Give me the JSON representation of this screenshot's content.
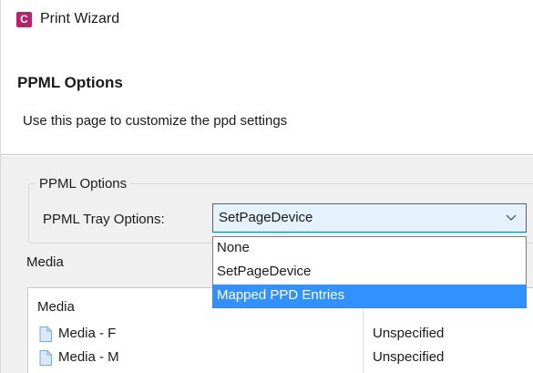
{
  "window": {
    "title": "Print Wizard",
    "app_icon_letter": "C",
    "app_icon_color": "#b8216b"
  },
  "header": {
    "title": "PPML Options",
    "description": "Use this page to customize the ppd settings"
  },
  "ppml_group": {
    "label": "PPML Options",
    "tray_options_label": "PPML Tray Options:",
    "tray_options_value": "SetPageDevice",
    "dropdown_options": [
      "None",
      "SetPageDevice",
      "Mapped PPD Entries"
    ],
    "highlighted_option": "Mapped PPD Entries"
  },
  "media": {
    "section_label": "Media",
    "table_header": "Media",
    "rows": [
      {
        "name": "Media - F",
        "value": "Unspecified"
      },
      {
        "name": "Media - M",
        "value": "Unspecified"
      }
    ]
  },
  "colors": {
    "accent": "#0078d7",
    "selection": "#3390ff",
    "combo_bg": "#e5f1fb",
    "panel_bg": "#f0f0f0"
  }
}
